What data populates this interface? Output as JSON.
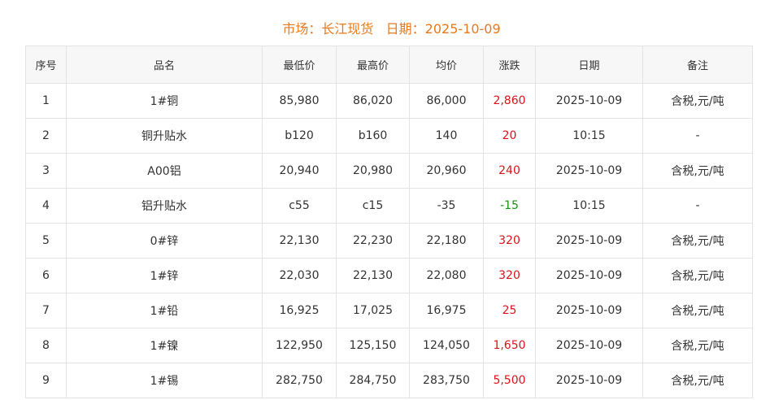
{
  "header": {
    "market_label": "市场：",
    "market_value": "长江现货",
    "date_label": "日期：",
    "date_value": "2025-10-09"
  },
  "colors": {
    "header": "#e8791b",
    "rise": "#d9141b",
    "fall": "#14940f",
    "border": "#e3e3e3",
    "header_bg": "#f7f7f7"
  },
  "table": {
    "columns": [
      "序号",
      "品名",
      "最低价",
      "最高价",
      "均价",
      "涨跌",
      "日期",
      "备注"
    ],
    "rows": [
      {
        "no": "1",
        "name": "1#铜",
        "low": "85,980",
        "high": "86,020",
        "avg": "86,000",
        "change": "2,860",
        "trend": "rise",
        "date": "2025-10-09",
        "note": "含税,元/吨"
      },
      {
        "no": "2",
        "name": "铜升贴水",
        "low": "b120",
        "high": "b160",
        "avg": "140",
        "change": "20",
        "trend": "rise",
        "date": "10:15",
        "note": "-"
      },
      {
        "no": "3",
        "name": "A00铝",
        "low": "20,940",
        "high": "20,980",
        "avg": "20,960",
        "change": "240",
        "trend": "rise",
        "date": "2025-10-09",
        "note": "含税,元/吨"
      },
      {
        "no": "4",
        "name": "铝升贴水",
        "low": "c55",
        "high": "c15",
        "avg": "-35",
        "change": "-15",
        "trend": "fall",
        "date": "10:15",
        "note": "-"
      },
      {
        "no": "5",
        "name": "0#锌",
        "low": "22,130",
        "high": "22,230",
        "avg": "22,180",
        "change": "320",
        "trend": "rise",
        "date": "2025-10-09",
        "note": "含税,元/吨"
      },
      {
        "no": "6",
        "name": "1#锌",
        "low": "22,030",
        "high": "22,130",
        "avg": "22,080",
        "change": "320",
        "trend": "rise",
        "date": "2025-10-09",
        "note": "含税,元/吨"
      },
      {
        "no": "7",
        "name": "1#铅",
        "low": "16,925",
        "high": "17,025",
        "avg": "16,975",
        "change": "25",
        "trend": "rise",
        "date": "2025-10-09",
        "note": "含税,元/吨"
      },
      {
        "no": "8",
        "name": "1#镍",
        "low": "122,950",
        "high": "125,150",
        "avg": "124,050",
        "change": "1,650",
        "trend": "rise",
        "date": "2025-10-09",
        "note": "含税,元/吨"
      },
      {
        "no": "9",
        "name": "1#锡",
        "low": "282,750",
        "high": "284,750",
        "avg": "283,750",
        "change": "5,500",
        "trend": "rise",
        "date": "2025-10-09",
        "note": "含税,元/吨"
      }
    ]
  }
}
